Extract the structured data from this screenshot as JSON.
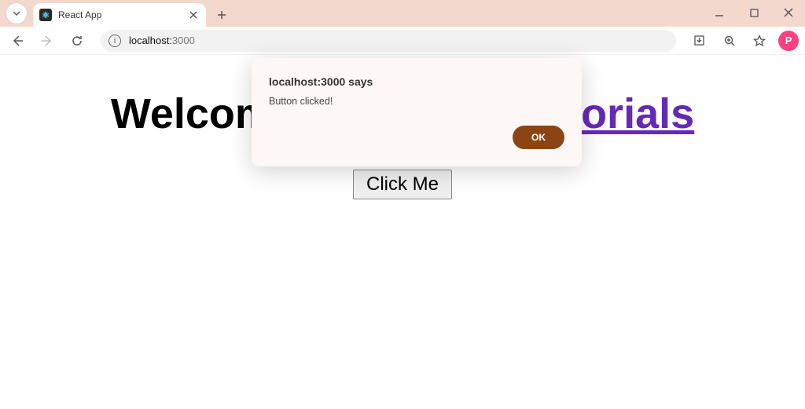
{
  "browser": {
    "tab_title": "React App",
    "window_controls": {
      "minimize": "—",
      "maximize": "▢",
      "close": "×"
    }
  },
  "toolbar": {
    "url_host": "localhost:",
    "url_port_path": "3000",
    "profile_initial": "P"
  },
  "page": {
    "heading_plain": "Welcome ",
    "heading_link": "s React.js Tutorials",
    "button_label": "Click Me"
  },
  "alert": {
    "title": "localhost:3000 says",
    "message": "Button clicked!",
    "ok_label": "OK"
  }
}
